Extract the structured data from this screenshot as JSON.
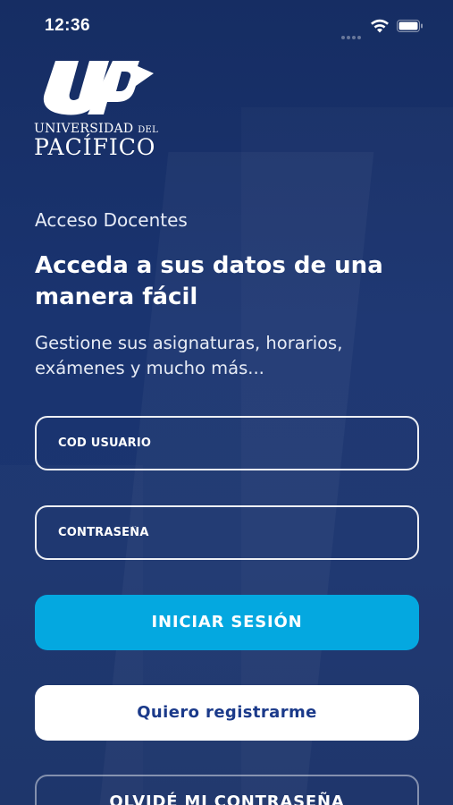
{
  "status_bar": {
    "time": "12:36",
    "signal_icon": "cellular-signal-icon",
    "wifi_icon": "wifi-icon",
    "battery_icon": "battery-icon"
  },
  "logo": {
    "mark_text": "UP",
    "line1_main": "UNIVERSIDAD",
    "line1_small": "DEL",
    "line2": "PACÍFICO"
  },
  "login": {
    "subtitle": "Acceso Docentes",
    "headline": "Acceda a sus datos de una manera fácil",
    "description": "Gestione sus asignaturas, horarios, exámenes y mucho más...",
    "user_placeholder": "COD USUARIO",
    "user_value": "",
    "password_placeholder": "CONTRASEÑA",
    "password_value": "",
    "login_button": "INICIAR SESIÓN",
    "register_button": "Quiero registrarme",
    "forgot_button": "OLVIDÉ MI CONTRASEÑA"
  },
  "colors": {
    "background": "#1a3470",
    "accent": "#04a8e0",
    "register_text": "#1b3a8a",
    "white": "#ffffff"
  }
}
